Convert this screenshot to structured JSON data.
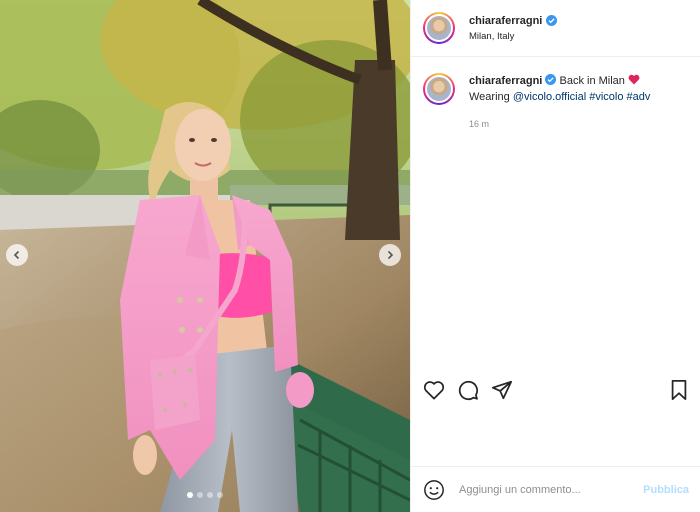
{
  "post": {
    "username": "chiaraferragni",
    "location": "Milan, Italy",
    "caption": {
      "text": "Back in Milan",
      "line2_prefix": "Wearing ",
      "mention": "@vicolo.official",
      "tags": [
        "#vicolo",
        "#adv"
      ]
    },
    "timestamp": "16 m",
    "carousel": {
      "slides": 4,
      "active_index": 0
    }
  },
  "comment_box": {
    "placeholder": "Aggiungi un commento...",
    "publish_label": "Pubblica"
  },
  "icons": {
    "verified": "verified-badge-icon",
    "heart_emoji": "red-heart-emoji",
    "like": "heart-icon",
    "comment": "comment-bubble-icon",
    "share": "paper-plane-icon",
    "save": "bookmark-icon",
    "emoji": "smiley-icon",
    "prev": "chevron-left-icon",
    "next": "chevron-right-icon"
  },
  "colors": {
    "verified_blue": "#3897f0",
    "link_blue": "#00376b",
    "publish_disabled": "#b2dffc",
    "muted": "#8e8e8e",
    "text": "#262626"
  }
}
